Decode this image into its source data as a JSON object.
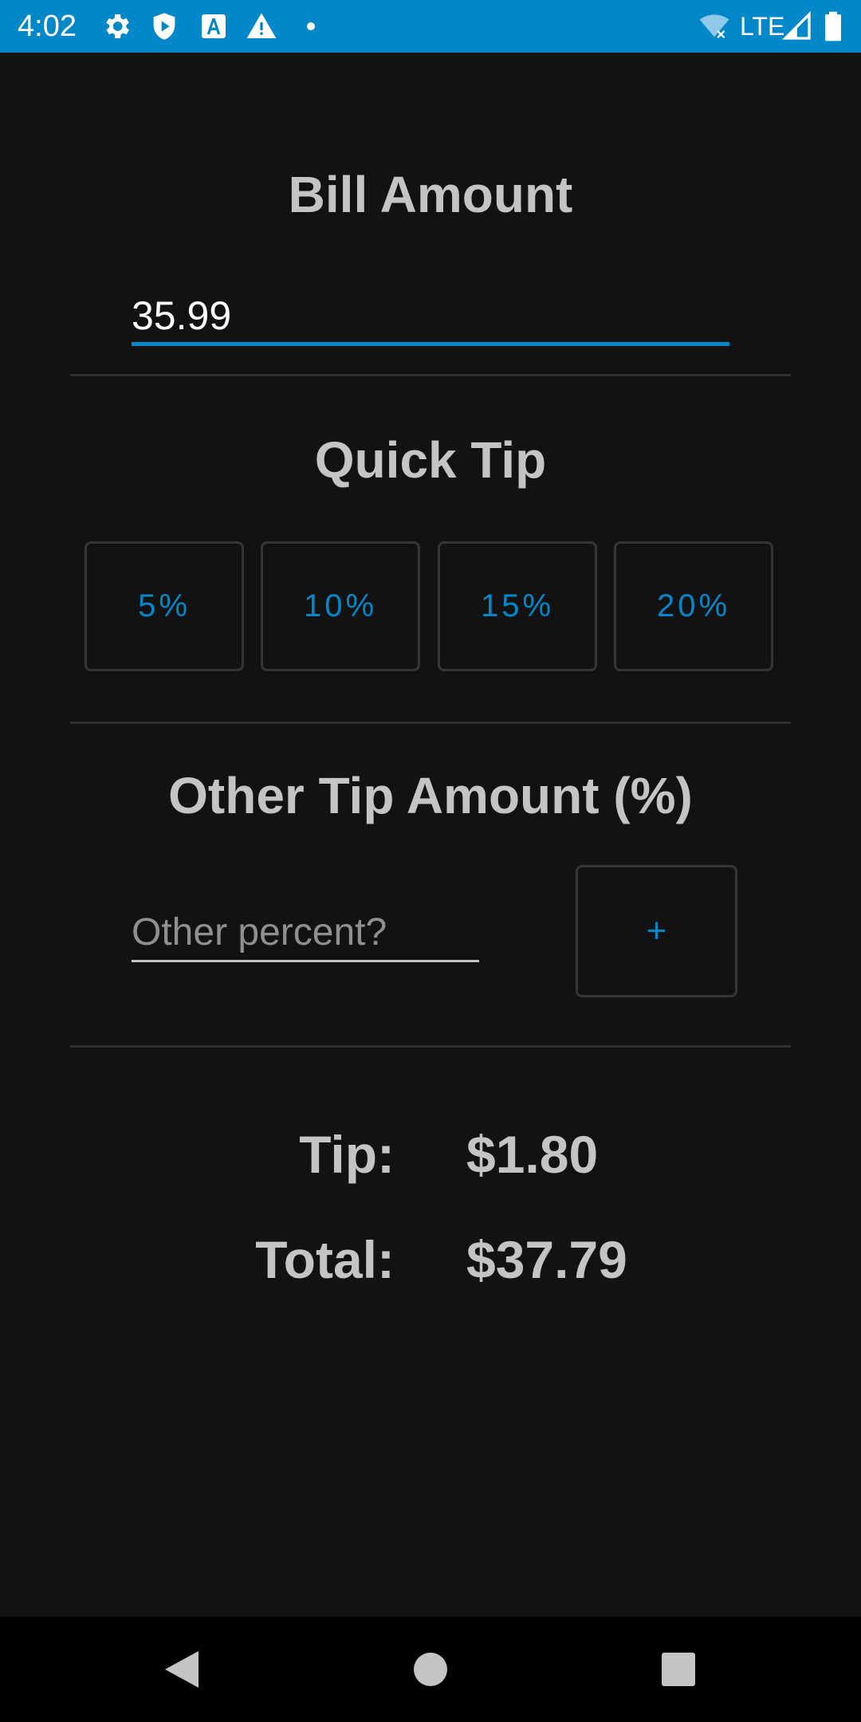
{
  "status_bar": {
    "time": "4:02",
    "network": "LTE",
    "icons": [
      "gear-icon",
      "shield-icon",
      "font-a-icon",
      "warning-icon",
      "dot-icon",
      "wifi-off-icon",
      "signal-icon",
      "battery-icon"
    ]
  },
  "bill": {
    "title": "Bill Amount",
    "value": "35.99"
  },
  "quick_tip": {
    "title": "Quick Tip",
    "buttons": [
      "5%",
      "10%",
      "15%",
      "20%"
    ]
  },
  "other_tip": {
    "title": "Other Tip Amount (%)",
    "placeholder": "Other percent?",
    "plus_label": "+"
  },
  "results": {
    "tip_label": "Tip:",
    "tip_value": "$1.80",
    "total_label": "Total:",
    "total_value": "$37.79"
  },
  "nav": {
    "icons": [
      "back-icon",
      "home-icon",
      "recents-icon"
    ]
  },
  "colors": {
    "accent": "#0288c9",
    "background": "#121212",
    "text": "#c4c4c4"
  }
}
